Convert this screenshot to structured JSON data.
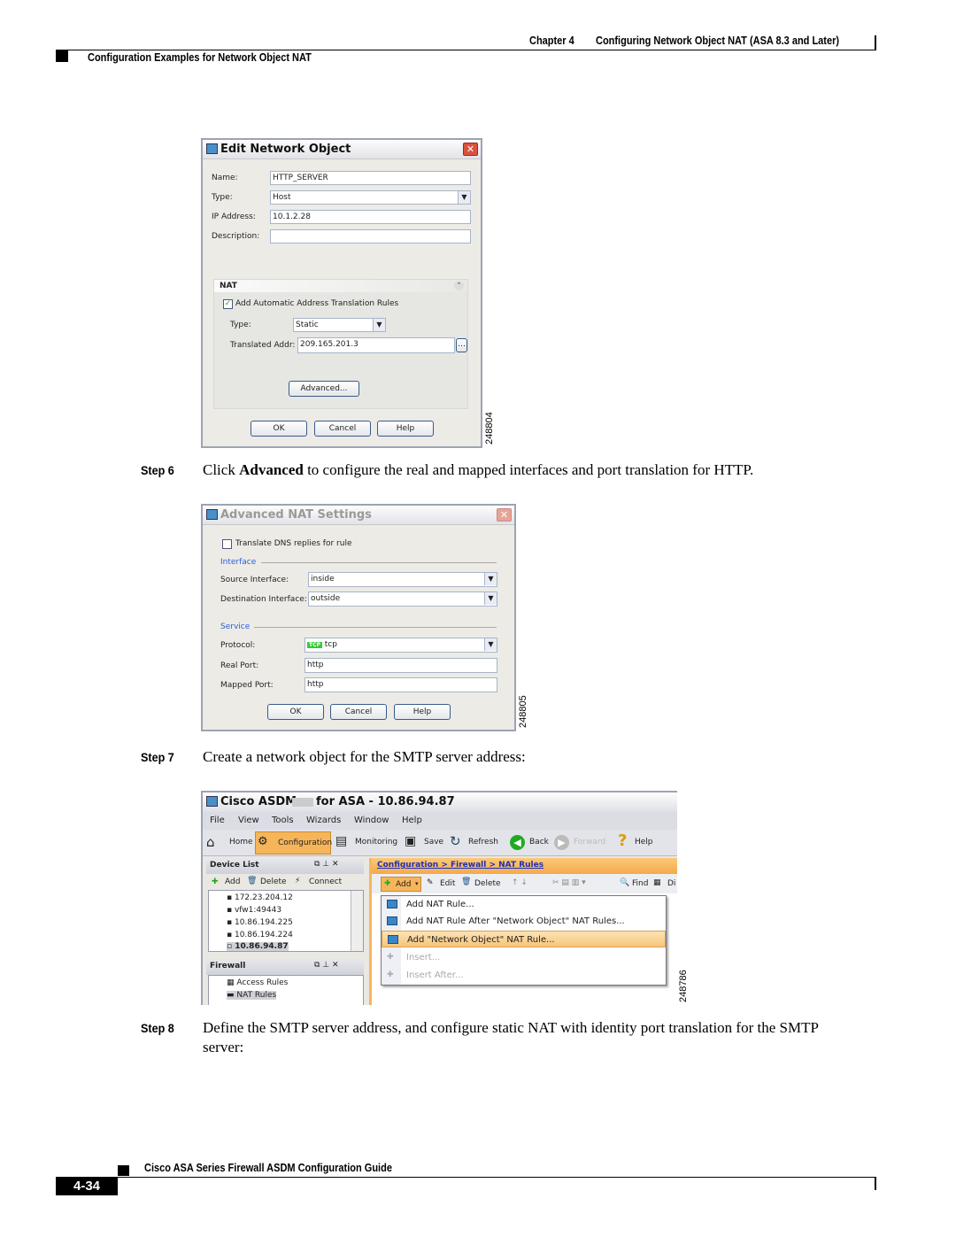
{
  "header": {
    "chapter": "Chapter 4",
    "chapter_title": "Configuring Network Object NAT (ASA 8.3 and Later)",
    "section": "Configuration Examples for Network Object NAT"
  },
  "dialog1": {
    "title": "Edit Network Object",
    "name_label": "Name:",
    "name_value": "HTTP_SERVER",
    "type_label": "Type:",
    "type_value": "Host",
    "ip_label": "IP Address:",
    "ip_value": "10.1.2.28",
    "desc_label": "Description:",
    "desc_value": "",
    "nat_header": "NAT",
    "auto_rules_label": "Add Automatic Address Translation Rules",
    "auto_rules_checked": true,
    "nat_type_label": "Type:",
    "nat_type_value": "Static",
    "translated_label": "Translated Addr:",
    "translated_value": "209.165.201.3",
    "advanced_button": "Advanced...",
    "ok": "OK",
    "cancel": "Cancel",
    "help": "Help",
    "figure_id": "248804"
  },
  "step6": {
    "label": "Step 6",
    "text_before": "Click ",
    "bold": "Advanced",
    "text_after": " to configure the real and mapped interfaces and port translation for HTTP."
  },
  "dialog2": {
    "title": "Advanced NAT Settings",
    "dns_label": "Translate DNS replies for rule",
    "dns_checked": false,
    "interface_group": "Interface",
    "source_label": "Source Interface:",
    "source_value": "inside",
    "dest_label": "Destination Interface:",
    "dest_value": "outside",
    "service_group": "Service",
    "protocol_label": "Protocol:",
    "protocol_icon": "TCP",
    "protocol_value": "tcp",
    "real_port_label": "Real Port:",
    "real_port_value": "http",
    "mapped_port_label": "Mapped Port:",
    "mapped_port_value": "http",
    "ok": "OK",
    "cancel": "Cancel",
    "help": "Help",
    "figure_id": "248805"
  },
  "step7": {
    "label": "Step 7",
    "text": "Create a network object for the SMTP server address:"
  },
  "asdm": {
    "title_left": "Cisco ASDM",
    "title_right": "for ASA - 10.86.94.87",
    "menu": [
      "File",
      "View",
      "Tools",
      "Wizards",
      "Window",
      "Help"
    ],
    "toolbar": [
      "Home",
      "Configuration",
      "Monitoring",
      "Save",
      "Refresh",
      "Back",
      "Forward",
      "Help"
    ],
    "device_list": {
      "title": "Device List",
      "add": "Add",
      "delete": "Delete",
      "connect": "Connect",
      "items": [
        "172.23.204.12",
        "vfw1:49443",
        "10.86.194.225",
        "10.86.194.224",
        "10.86.94.87"
      ]
    },
    "firewall": {
      "title": "Firewall",
      "items": [
        "Access Rules",
        "NAT Rules"
      ]
    },
    "breadcrumb": "Configuration > Firewall > NAT Rules",
    "actions": {
      "add": "Add",
      "edit": "Edit",
      "delete": "Delete",
      "find": "Find",
      "di": "Di"
    },
    "menu_items": [
      {
        "label": "Add NAT Rule...",
        "enabled": true
      },
      {
        "label": "Add NAT Rule After \"Network Object\" NAT Rules...",
        "enabled": true
      },
      {
        "label": "Add \"Network Object\" NAT Rule...",
        "enabled": true,
        "highlighted": true
      },
      {
        "label": "Insert...",
        "enabled": false
      },
      {
        "label": "Insert After...",
        "enabled": false
      }
    ],
    "figure_id": "248786",
    "accent": "#f7b55a"
  },
  "step8": {
    "label": "Step 8",
    "line1": "Define the SMTP server address, and configure static NAT with identity port translation for the SMTP",
    "line2": "server:"
  },
  "footer": {
    "guide": "Cisco ASA Series Firewall ASDM Configuration Guide",
    "page": "4-34"
  }
}
